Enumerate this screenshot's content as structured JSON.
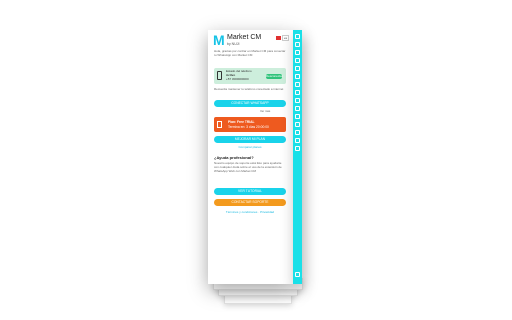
{
  "header": {
    "logo": "M",
    "title": "Market CM",
    "subtitle": "by NUJI",
    "language": "es"
  },
  "intro_text": "Hola, gracias por confiar en Market CM para conectar tu WhatsApp con Market CM",
  "connection": {
    "label": "Estado del teléfono",
    "status": "Activo",
    "number": "+57 3000000000",
    "button": "Desconectar"
  },
  "note_text": "Recuerda mantener tu teléfono conectado a internet",
  "connect_button": "CONECTAR WHATSAPP",
  "small_link": "Ver más",
  "plan": {
    "label": "Plan: Free TRIAL",
    "expiry": "Termina en: 3 días 20:00:00"
  },
  "upgrade_button": "MEJORAR MI PLAN",
  "plan_link": "Comparar planes",
  "help": {
    "title": "¿Ayuda profesional?",
    "body": "Nuestro equipo de soporte está listo para ayudarte con cualquier duda sobre el uso de la extensión de WhatsApp Web con Market CM"
  },
  "help_button": "VER TUTORIAL",
  "support_button": "CONTACTAR SOPORTE",
  "footer_link": "Términos y condiciones · Privacidad",
  "colors": {
    "accent": "#19e0e8",
    "orange": "#f39a1e",
    "red": "#ee5a1f",
    "green_bg": "#cdeedc"
  }
}
